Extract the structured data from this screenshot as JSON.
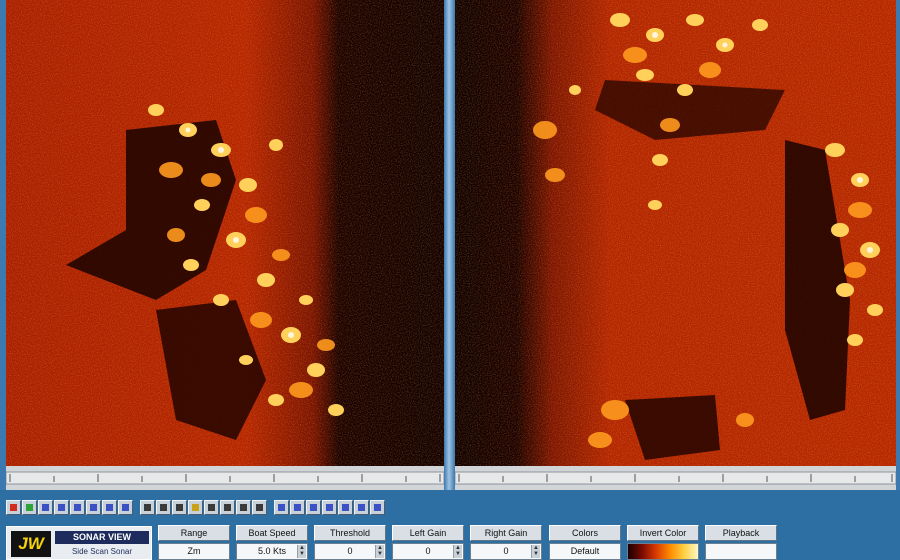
{
  "app": {
    "logo_mark": "JW",
    "logo_title": "SONAR VIEW",
    "logo_subtitle": "Side Scan Sonar"
  },
  "panes": {
    "left": {
      "label": "port-channel-image"
    },
    "right": {
      "label": "starboard-channel-image"
    }
  },
  "toolbar": {
    "buttons": [
      {
        "icon": "stop-icon",
        "color": "#d22a1f"
      },
      {
        "icon": "record-icon",
        "color": "#2ea33a"
      },
      {
        "icon": "rewind-icon",
        "color": "#3a52c4"
      },
      {
        "icon": "step-back-icon",
        "color": "#3a52c4"
      },
      {
        "icon": "play-icon",
        "color": "#3a52c4"
      },
      {
        "icon": "step-forward-icon",
        "color": "#3a52c4"
      },
      {
        "icon": "fast-forward-icon",
        "color": "#3a52c4"
      },
      {
        "icon": "pause-icon",
        "color": "#3a52c4"
      },
      {
        "icon": "open-icon",
        "color": "#3a3a3a"
      },
      {
        "icon": "save-icon",
        "color": "#3a3a3a"
      },
      {
        "icon": "print-icon",
        "color": "#3a3a3a"
      },
      {
        "icon": "folder-icon",
        "color": "#c9a21a"
      },
      {
        "icon": "zoom-in-icon",
        "color": "#3a3a3a"
      },
      {
        "icon": "zoom-out-icon",
        "color": "#3a3a3a"
      },
      {
        "icon": "grid-icon",
        "color": "#3a3a3a"
      },
      {
        "icon": "marker-icon",
        "color": "#3a3a3a"
      },
      {
        "icon": "measure-icon",
        "color": "#3a52c4"
      },
      {
        "icon": "target-icon",
        "color": "#3a52c4"
      },
      {
        "icon": "chart-icon",
        "color": "#3a52c4"
      },
      {
        "icon": "layer-icon",
        "color": "#3a52c4"
      },
      {
        "icon": "settings-icon",
        "color": "#3a52c4"
      },
      {
        "icon": "help-icon",
        "color": "#3a52c4"
      },
      {
        "icon": "about-icon",
        "color": "#3a52c4"
      }
    ]
  },
  "controls": {
    "range": {
      "label": "Range",
      "value": "Zm"
    },
    "boat_speed": {
      "label": "Boat Speed",
      "value": "5.0 Kts"
    },
    "threshold": {
      "label": "Threshold",
      "value": "0"
    },
    "left_gain": {
      "label": "Left Gain",
      "value": "0"
    },
    "right_gain": {
      "label": "Right Gain",
      "value": "0"
    },
    "colors": {
      "label": "Colors",
      "value": "Default"
    },
    "invert_colors": {
      "label": "Invert Color"
    },
    "playback": {
      "label": "Playback",
      "value": ""
    }
  }
}
